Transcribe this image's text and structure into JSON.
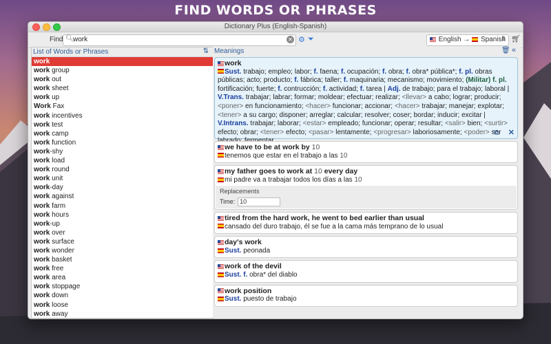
{
  "banner": "FIND WORDS OR PHRASES",
  "window": {
    "title": "Dictionary Plus (English-Spanish)"
  },
  "toolbar": {
    "find_label": "Find:",
    "search_value": "work",
    "lang_from": "English",
    "lang_arrow": "→",
    "lang_to": "Spanish"
  },
  "list": {
    "header": "List of Words or Phrases",
    "items": [
      {
        "bold": "work",
        "rest": ""
      },
      {
        "bold": "work",
        "rest": " group"
      },
      {
        "bold": "work",
        "rest": " out"
      },
      {
        "bold": "work",
        "rest": " sheet"
      },
      {
        "bold": "work",
        "rest": " up"
      },
      {
        "bold": "Work",
        "rest": " Fax"
      },
      {
        "bold": "work",
        "rest": " incentives"
      },
      {
        "bold": "work",
        "rest": " test"
      },
      {
        "bold": "work",
        "rest": " camp"
      },
      {
        "bold": "work",
        "rest": " function"
      },
      {
        "bold": "work",
        "rest": "-shy"
      },
      {
        "bold": "work",
        "rest": " load"
      },
      {
        "bold": "work",
        "rest": " round"
      },
      {
        "bold": "work",
        "rest": " unit"
      },
      {
        "bold": "work",
        "rest": "-day"
      },
      {
        "bold": "work",
        "rest": " against"
      },
      {
        "bold": "work",
        "rest": " farm"
      },
      {
        "bold": "work",
        "rest": " hours"
      },
      {
        "bold": "work",
        "rest": "-up"
      },
      {
        "bold": "work",
        "rest": " over"
      },
      {
        "bold": "work",
        "rest": " surface"
      },
      {
        "bold": "work",
        "rest": " wonder"
      },
      {
        "bold": "work",
        "rest": " basket"
      },
      {
        "bold": "work",
        "rest": " free"
      },
      {
        "bold": "work",
        "rest": " area"
      },
      {
        "bold": "work",
        "rest": " stoppage"
      },
      {
        "bold": "work",
        "rest": " down"
      },
      {
        "bold": "work",
        "rest": " loose"
      },
      {
        "bold": "work",
        "rest": " away"
      }
    ]
  },
  "meanings": {
    "header": "Meanings",
    "main": {
      "head": "work",
      "sust_label": "Sust.",
      "sust_text_1": " trabajo; empleo; labor; ",
      "f1": "f.",
      "t1": " faena; ",
      "f2": "f.",
      "t2": " ocupación; ",
      "f3": "f.",
      "t3": " obra; ",
      "f4": "f.",
      "t4": " obra* pública*; ",
      "fpl1": "f. pl.",
      "t5": " obras públicas; acto; producto; ",
      "f5": "f.",
      "t6": " fábrica; taller; ",
      "f6": "f.",
      "t7": " maquinaria; mecanismo; movimiento; ",
      "mil": "(Militar) f. pl.",
      "t8": " fortificación; fuerte; ",
      "f7": "f.",
      "t9": " contrucción; ",
      "f8": "f.",
      "t10": " actividad; ",
      "f9": "f.",
      "t11": " tarea | ",
      "adj": "Adj.",
      "t12": " de trabajo; para el trabajo; laboral | ",
      "vtrans": "V.Trans.",
      "t13": " trabajar; labrar; formar; moldear; efectuar; realizar; ",
      "p1": "<llevar>",
      "t14": " a cabo; lograr; producir; ",
      "p2": "<poner>",
      "t15": " en funcionamiento; ",
      "p3": "<hacer>",
      "t16": " funcionar; accionar; ",
      "p4": "<hacer>",
      "t17": " trabajar; manejar; explotar; ",
      "p5": "<tener>",
      "t18": " a su cargo; disponer; arreglar; calcular; resolver; coser; bordar; inducir; excitar | ",
      "vintrans": "V.Intrans.",
      "t19": " trabajar; laborar; ",
      "p6": "<estar>",
      "t20": " empleado; funcionar; operar; resultar; ",
      "p7": "<salir>",
      "t21": " bien; ",
      "p8": "<surtir>",
      "t22": " efecto; obrar; ",
      "p9": "<tener>",
      "t23": " efecto; ",
      "p10": "<pasar>",
      "t24": " lentamente; ",
      "p11": "<progresar>",
      "t25": " laboriosamente; ",
      "p12": "<poder>",
      "t26": " ser labrado; fermentar"
    },
    "card2": {
      "head": "we have to be at work by ",
      "num": "10",
      "trans": "tenemos que estar en el trabajo a las ",
      "trans_num": "10"
    },
    "card3": {
      "head": "my father goes to work at ",
      "num": "10",
      "head_tail": " every day",
      "trans": "mi padre va a trabajar todos los días a las ",
      "trans_num": "10",
      "repl_title": "Replacements",
      "repl_label": "Time:",
      "repl_value": "10"
    },
    "card4": {
      "head": "tired from the hard work, he went to bed earlier than usual",
      "trans": "cansado del duro trabajo, él se fue a la cama más temprano de lo usual"
    },
    "card5": {
      "head": "day's work",
      "sust": "Sust.",
      "trans": " peonada"
    },
    "card6": {
      "head": "work of the devil",
      "sust": "Sust.",
      "f": "f.",
      "trans": " obra* del diablo"
    },
    "card7": {
      "head": "work position",
      "sust": "Sust.",
      "trans": " puesto de trabajo"
    }
  },
  "colors": {
    "selected_row": "#e03b36",
    "accent_blue": "#2e5d9a",
    "main_card_bg": "#e6f3fb"
  }
}
